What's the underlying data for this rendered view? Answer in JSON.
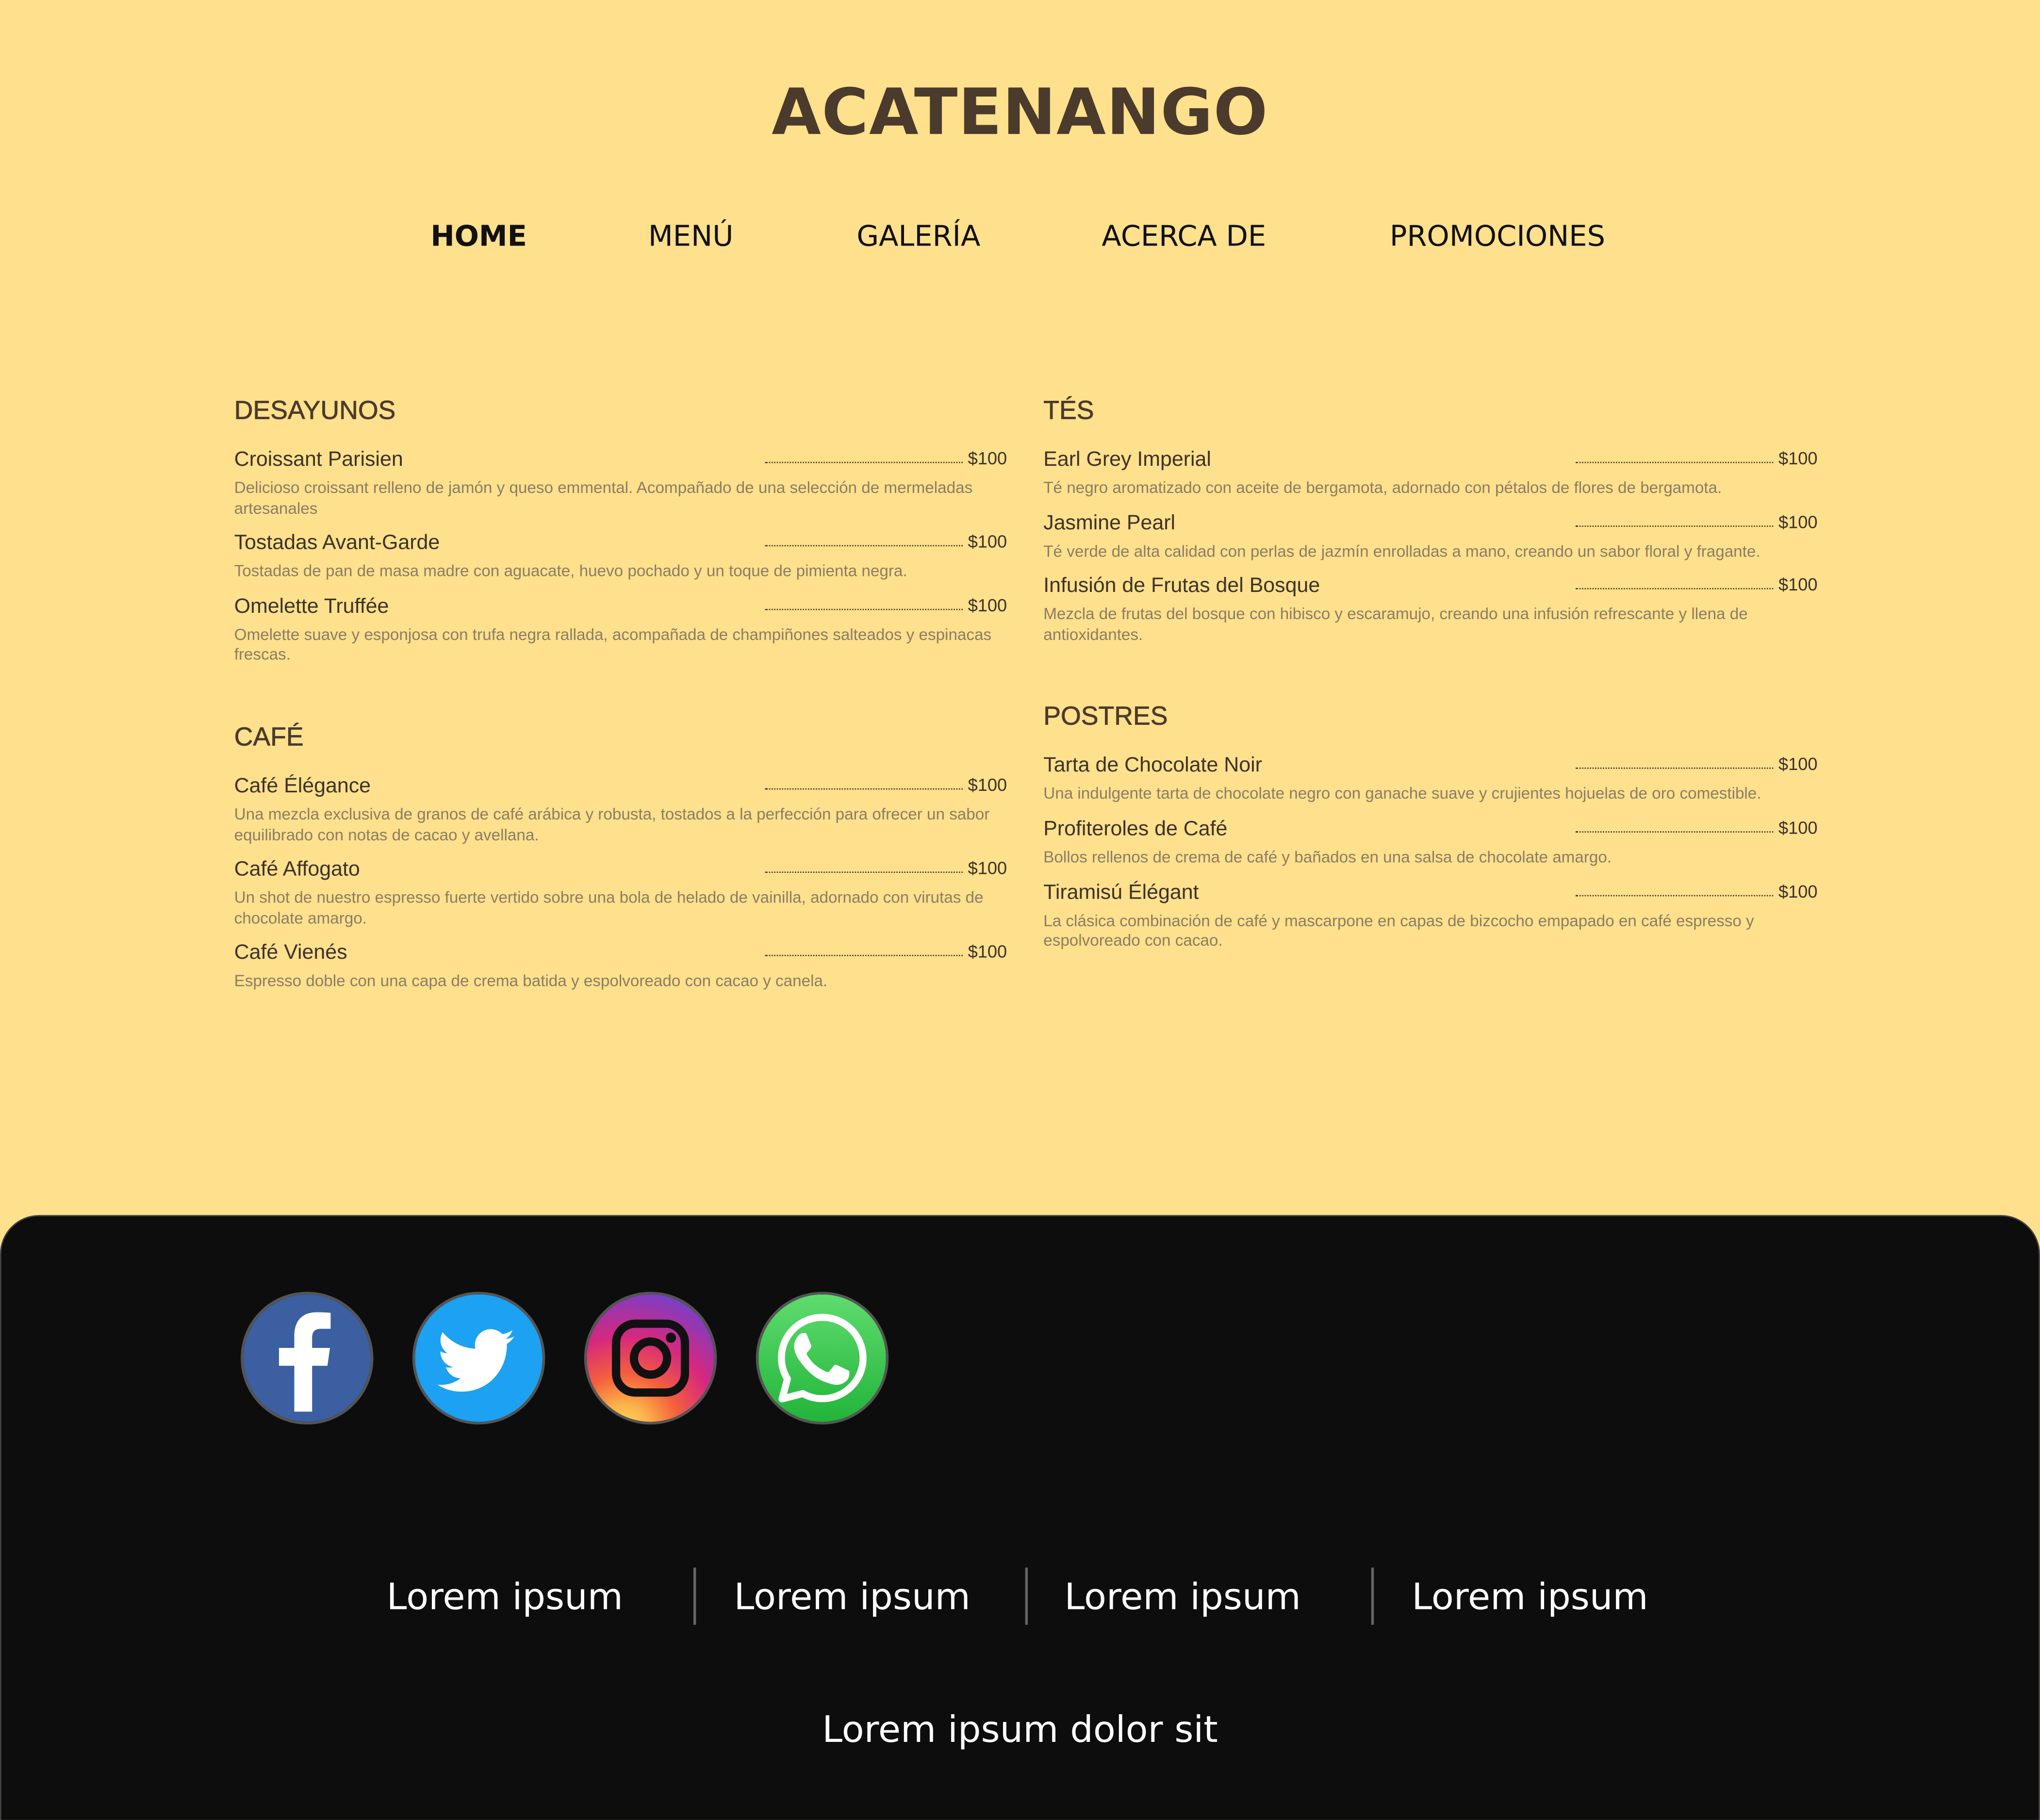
{
  "site": {
    "title": "ACATENANGO"
  },
  "nav": {
    "items": [
      {
        "label": "HOME"
      },
      {
        "label": "MENÚ"
      },
      {
        "label": "GALERÍA"
      },
      {
        "label": "ACERCA DE"
      },
      {
        "label": "PROMOCIONES"
      }
    ],
    "active": "HOME"
  },
  "menu": {
    "left": [
      {
        "title": "DESAYUNOS",
        "items": [
          {
            "name": "Croissant Parisien",
            "price": "$100",
            "desc": "Delicioso croissant relleno de jamón y queso emmental. Acompañado de una selección de mermeladas artesanales"
          },
          {
            "name": "Tostadas Avant-Garde",
            "price": "$100",
            "desc": "Tostadas de pan de masa madre con aguacate, huevo pochado y un toque de pimienta negra."
          },
          {
            "name": "Omelette Truffée",
            "price": "$100",
            "desc": "Omelette suave y esponjosa con trufa negra rallada, acompañada de champiñones salteados y espinacas frescas."
          }
        ]
      },
      {
        "title": "CAFÉ",
        "items": [
          {
            "name": "Café Élégance",
            "price": "$100",
            "desc": "Una mezcla exclusiva de granos de café arábica y robusta, tostados a la perfección para ofrecer un sabor equilibrado con notas de cacao y avellana."
          },
          {
            "name": "Café Affogato",
            "price": "$100",
            "desc": "Un shot de nuestro espresso fuerte vertido sobre una bola de helado de vainilla, adornado con virutas de chocolate amargo."
          },
          {
            "name": "Café Vienés",
            "price": "$100",
            "desc": "Espresso doble con una capa de crema batida y espolvoreado con cacao y canela."
          }
        ]
      }
    ],
    "right": [
      {
        "title": "TÉS",
        "items": [
          {
            "name": "Earl Grey Imperial",
            "price": "$100",
            "desc": "Té negro aromatizado con aceite de bergamota, adornado con pétalos de flores de bergamota."
          },
          {
            "name": "Jasmine Pearl",
            "price": "$100",
            "desc": "Té verde de alta calidad con perlas de jazmín enrolladas a mano, creando un sabor floral y fragante."
          },
          {
            "name": "Infusión de Frutas del Bosque",
            "price": "$100",
            "desc": "Mezcla de frutas del bosque con hibisco y escaramujo, creando una infusión refrescante y llena de antioxidantes."
          }
        ]
      },
      {
        "title": "POSTRES",
        "items": [
          {
            "name": "Tarta de Chocolate Noir",
            "price": "$100",
            "desc": "Una indulgente tarta de chocolate negro con ganache suave y crujientes hojuelas de oro comestible."
          },
          {
            "name": "Profiteroles de Café",
            "price": "$100",
            "desc": "Bollos rellenos de crema de café y bañados en una salsa de chocolate amargo."
          },
          {
            "name": "Tiramisú Élégant",
            "price": "$100",
            "desc": "La clásica combinación de café y mascarpone en capas de bizcocho empapado en café espresso y espolvoreado con cacao."
          }
        ]
      }
    ]
  },
  "footer": {
    "social": [
      {
        "icon": "facebook-icon",
        "color": "#3b5fa0"
      },
      {
        "icon": "twitter-icon",
        "color": "#1da1f2"
      },
      {
        "icon": "instagram-icon",
        "color": "#c13584"
      },
      {
        "icon": "whatsapp-icon",
        "color": "#2cb742"
      }
    ],
    "links": [
      "Lorem ipsum",
      "Lorem ipsum",
      "Lorem ipsum",
      "Lorem ipsum"
    ],
    "copyright": "Lorem ipsum dolor sit"
  },
  "colors": {
    "background": "#FFE08C",
    "title": "#4a3b2c",
    "footer_bg": "#0d0d0d"
  }
}
